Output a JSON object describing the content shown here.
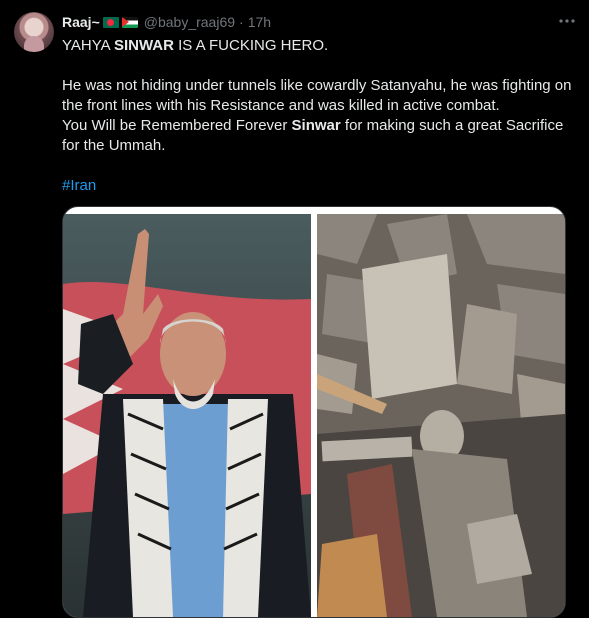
{
  "tweet": {
    "display_name": "Raaj~",
    "handle": "@baby_raaj69",
    "separator": "·",
    "time": "17h",
    "more_icon": "more-horizontal-icon",
    "line1_pre": "YAHYA ",
    "line1_bold": "SINWAR",
    "line1_post": " IS A FUCKING HERO.",
    "p2_text": "He was not hiding under tunnels like cowardly Satanyahu, he was fighting on the front lines with his Resistance and was killed in active combat.",
    "p3_pre": "You Will be Remembered Forever ",
    "p3_bold": "Sinwar",
    "p3_post": " for making such a great Sacrifice for the Ummah.",
    "hashtag": "#Iran"
  },
  "colors": {
    "background": "#000000",
    "text": "#e7e9ea",
    "muted": "#71767b",
    "link": "#1d9bf0",
    "border": "#2f3336"
  }
}
